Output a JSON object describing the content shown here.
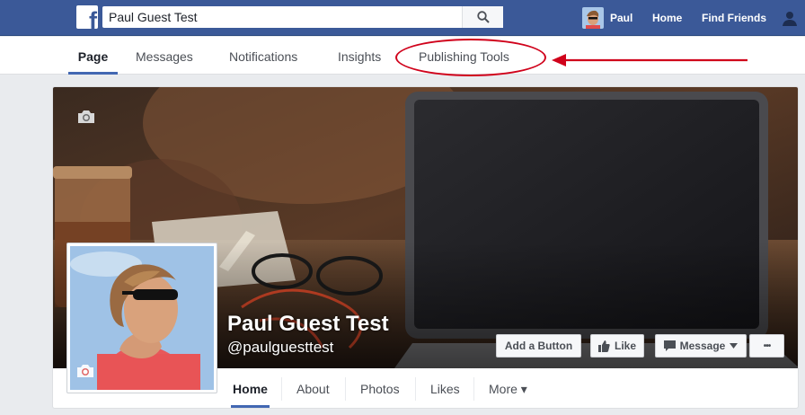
{
  "topbar": {
    "search_value": "Paul Guest Test",
    "user_name": "Paul",
    "home_label": "Home",
    "find_friends_label": "Find Friends",
    "icons": [
      "facebook-logo-icon",
      "search-icon",
      "friend-requests-icon"
    ]
  },
  "page_tabs": [
    {
      "label": "Page",
      "active": true
    },
    {
      "label": "Messages",
      "active": false
    },
    {
      "label": "Notifications",
      "active": false
    },
    {
      "label": "Insights",
      "active": false
    },
    {
      "label": "Publishing Tools",
      "active": false
    }
  ],
  "annotation": {
    "color": "#d0021b"
  },
  "profile": {
    "name": "Paul Guest Test",
    "handle": "@paulguesttest"
  },
  "actions": {
    "add_button": "Add a Button",
    "like": "Like",
    "message": "Message",
    "more": "•••"
  },
  "bottom_tabs": [
    {
      "label": "Home",
      "active": true
    },
    {
      "label": "About",
      "active": false
    },
    {
      "label": "Photos",
      "active": false
    },
    {
      "label": "Likes",
      "active": false
    },
    {
      "label": "More ▾",
      "active": false
    }
  ],
  "colors": {
    "brand": "#3b5998",
    "accent": "#4267b2",
    "background": "#e9ebee"
  }
}
